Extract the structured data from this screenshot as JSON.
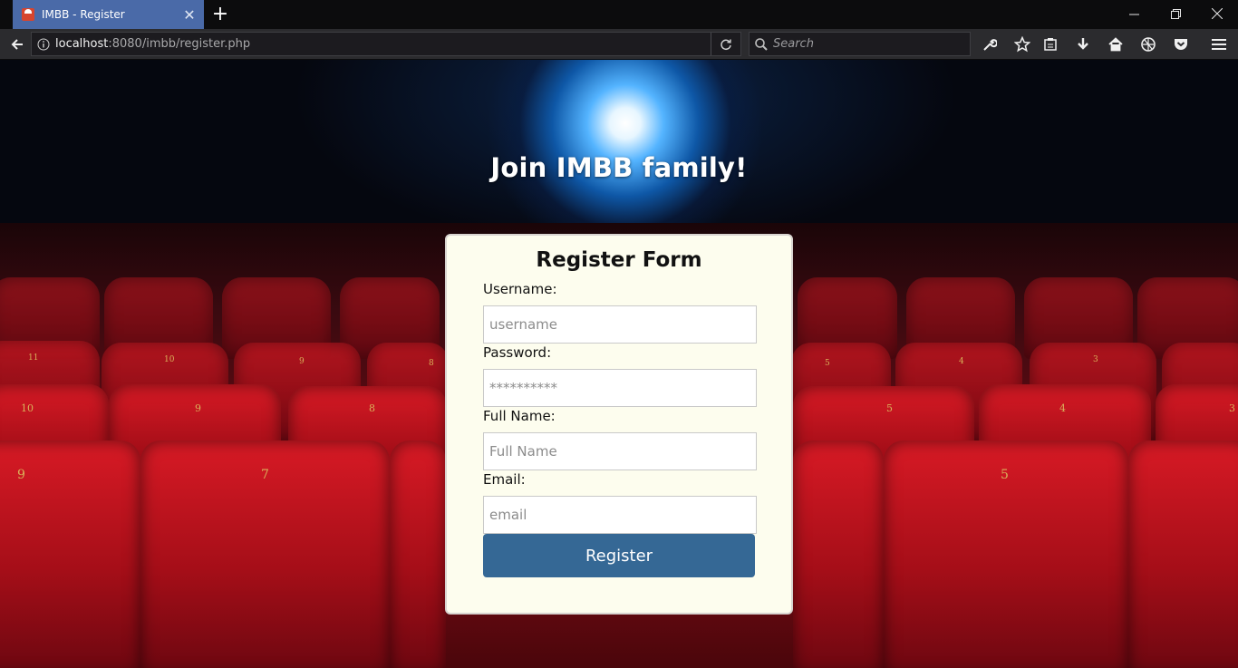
{
  "browser": {
    "tab_title": "IMBB - Register",
    "new_tab_label": "+",
    "url_host": "localhost",
    "url_rest": ":8080/imbb/register.php",
    "search_placeholder": "Search"
  },
  "page": {
    "heading": "Join IMBB family!"
  },
  "form": {
    "title": "Register Form",
    "username_label": "Username:",
    "username_placeholder": "username",
    "password_label": "Password:",
    "password_placeholder": "**********",
    "fullname_label": "Full Name:",
    "fullname_placeholder": "Full Name",
    "email_label": "Email:",
    "email_placeholder": "email",
    "submit_label": "Register"
  },
  "seat_numbers": [
    "11",
    "10",
    "9",
    "8",
    "5",
    "4",
    "3",
    "10",
    "9",
    "8",
    "5",
    "4",
    "3",
    "9",
    "7",
    "5"
  ],
  "colors": {
    "tab_active": "#4a6aa8",
    "card_background": "#fdfdee",
    "button": "#356895",
    "seat_red": "#c8151f"
  }
}
